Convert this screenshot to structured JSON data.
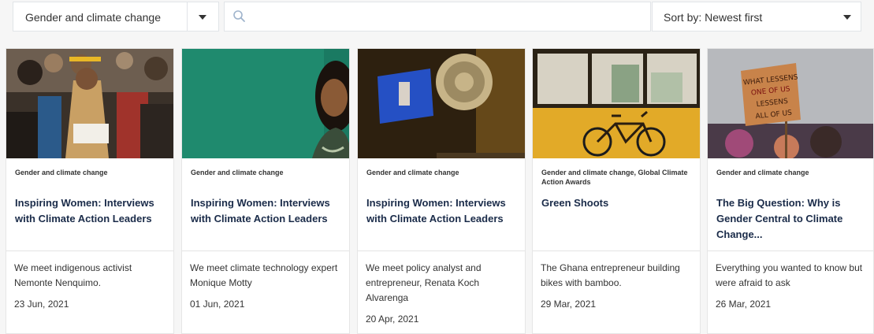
{
  "filters": {
    "topic": "Gender and climate change",
    "search_placeholder": "",
    "sort": "Sort by: Newest first"
  },
  "articles": [
    {
      "category": "Gender and climate change",
      "title": "Inspiring Women: Interviews with Climate Action Leaders",
      "description": "We meet indigenous activist Nemonte Nenquimo.",
      "date": "23 Jun, 2021"
    },
    {
      "category": "Gender and climate change",
      "title": "Inspiring Women: Interviews with Climate Action Leaders",
      "description": "We meet climate technology expert Monique Motty",
      "date": "01 Jun, 2021"
    },
    {
      "category": "Gender and climate change",
      "title": "Inspiring Women: Interviews with Climate Action Leaders",
      "description": "We meet policy analyst and entrepreneur, Renata Koch Alvarenga",
      "date": "20 Apr, 2021"
    },
    {
      "category": "Gender and climate change, Global Climate Action Awards",
      "title": "Green Shoots",
      "description": "The Ghana entrepreneur building bikes with bamboo.",
      "date": "29 Mar, 2021"
    },
    {
      "category": "Gender and climate change",
      "title": "The Big Question: Why is Gender Central to Climate Change...",
      "description": "Everything you wanted to know but were afraid to ask",
      "date": "26 Mar, 2021",
      "sign_text": "WHAT LESSENS ONE OF US LESSENS ALL OF US"
    }
  ]
}
